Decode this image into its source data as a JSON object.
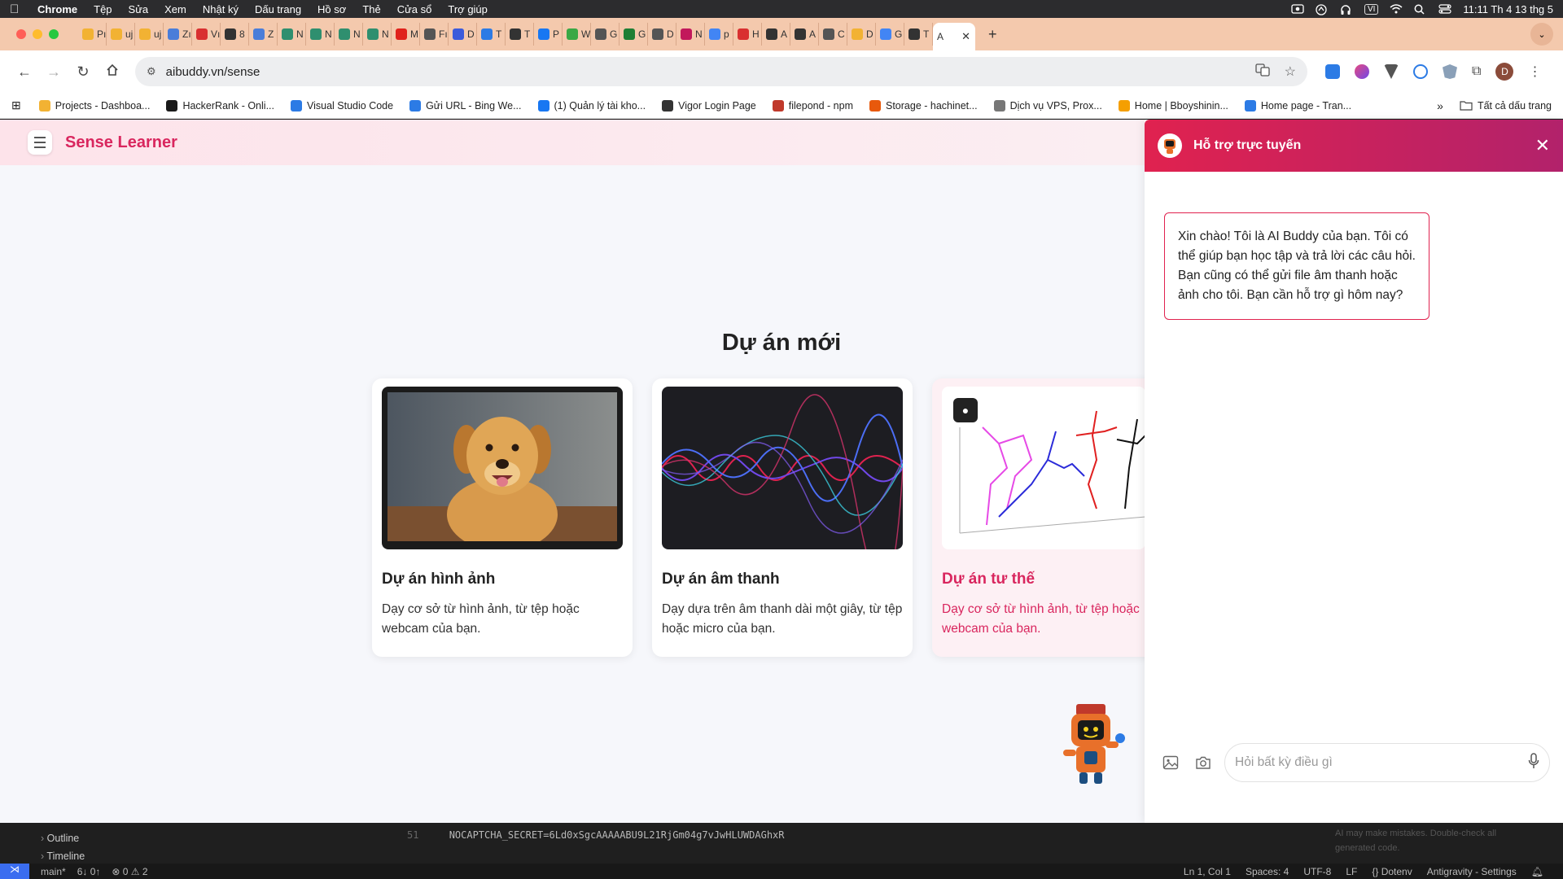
{
  "menubar": {
    "app": "Chrome",
    "items": [
      "Tệp",
      "Sửa",
      "Xem",
      "Nhật ký",
      "Dấu trang",
      "Hồ sơ",
      "Thẻ",
      "Cửa sổ",
      "Trợ giúp"
    ],
    "input_source": "VI",
    "clock": "11:11 Th 4 13 thg 5"
  },
  "tabs": [
    {
      "label": "Pı",
      "color": "#f2b233"
    },
    {
      "label": "uj",
      "color": "#f2b233"
    },
    {
      "label": "uj",
      "color": "#f2b233"
    },
    {
      "label": "Zı",
      "color": "#4a7dd9"
    },
    {
      "label": "Vı",
      "color": "#d93030"
    },
    {
      "label": "8",
      "color": "#333333"
    },
    {
      "label": "Z",
      "color": "#4a7dd9"
    },
    {
      "label": "N",
      "color": "#2f8f6f"
    },
    {
      "label": "N",
      "color": "#2f8f6f"
    },
    {
      "label": "N",
      "color": "#2f8f6f"
    },
    {
      "label": "N",
      "color": "#2f8f6f"
    },
    {
      "label": "M",
      "color": "#e0221b"
    },
    {
      "label": "Fı",
      "color": "#555555"
    },
    {
      "label": "D",
      "color": "#3b5bdb"
    },
    {
      "label": "T",
      "color": "#2c7be5"
    },
    {
      "label": "T",
      "color": "#333333"
    },
    {
      "label": "P",
      "color": "#1877f2"
    },
    {
      "label": "W",
      "color": "#3aa845"
    },
    {
      "label": "G",
      "color": "#555555"
    },
    {
      "label": "G",
      "color": "#1e7e34"
    },
    {
      "label": "D",
      "color": "#555555"
    },
    {
      "label": "N",
      "color": "#c2185b"
    },
    {
      "label": "p",
      "color": "#4285f4"
    },
    {
      "label": "H",
      "color": "#d93030"
    },
    {
      "label": "A",
      "color": "#333333"
    },
    {
      "label": "A",
      "color": "#333333"
    },
    {
      "label": "C",
      "color": "#555555"
    },
    {
      "label": "D",
      "color": "#f2b233"
    },
    {
      "label": "G",
      "color": "#4285f4"
    },
    {
      "label": "T",
      "color": "#333333"
    }
  ],
  "active_tab": {
    "label": "A"
  },
  "toolbar": {
    "url": "aibuddy.vn/sense",
    "profile_initial": "D"
  },
  "bookmarks": {
    "items": [
      {
        "label": "Projects - Dashboa...",
        "color": "#f2b233"
      },
      {
        "label": "HackerRank - Onli...",
        "color": "#1a1a1a"
      },
      {
        "label": "Visual Studio Code",
        "color": "#2c7be5"
      },
      {
        "label": "Gửi URL - Bing We...",
        "color": "#2c7be5"
      },
      {
        "label": "(1) Quản lý tài kho...",
        "color": "#1877f2"
      },
      {
        "label": "Vigor Login Page",
        "color": "#333333"
      },
      {
        "label": "filepond - npm",
        "color": "#c0392b"
      },
      {
        "label": "Storage - hachinet...",
        "color": "#e8590c"
      },
      {
        "label": "Dịch vụ VPS, Prox...",
        "color": "#777777"
      },
      {
        "label": "Home | Bboyshinin...",
        "color": "#f59f00"
      },
      {
        "label": "Home page - Tran...",
        "color": "#2c7be5"
      }
    ],
    "more": "»",
    "all": "Tất cả dấu trang"
  },
  "app": {
    "brand": "Sense Learner",
    "heading": "Dự án mới",
    "cards": [
      {
        "title": "Dự án hình ảnh",
        "desc": "Dạy cơ sở từ hình ảnh, từ tệp hoặc webcam của bạn."
      },
      {
        "title": "Dự án âm thanh",
        "desc": "Dạy dựa trên âm thanh dài một giây, từ tệp hoặc micro của bạn."
      },
      {
        "title": "Dự án tư thế",
        "desc": "Dạy cơ sở từ hình ảnh, từ tệp hoặc webcam của bạn."
      }
    ]
  },
  "chat": {
    "title": "Hỗ trợ trực tuyến",
    "greeting": "Xin chào! Tôi là AI Buddy của bạn. Tôi có thể giúp bạn học tập và trả lời các câu hỏi. Bạn cũng có thể gửi file âm thanh hoặc ảnh cho tôi. Bạn cần hỗ trợ gì hôm nay?",
    "placeholder": "Hỏi bất kỳ điều gì"
  },
  "editor": {
    "outline": "Outline",
    "timeline": "Timeline",
    "line_number": "51",
    "code": "NOCAPTCHA_SECRET=6Ld0xSgcAAAAABU9L21RjGm04g7vJwHLUWDAGhxR",
    "ai_note": "AI may make mistakes. Double-check all generated code."
  },
  "statusbar": {
    "branch": "main*",
    "sync": "6↓ 0↑",
    "problems": "⊗ 0 ⚠ 2",
    "position": "Ln 1, Col 1",
    "spaces": "Spaces: 4",
    "encoding": "UTF-8",
    "eol": "LF",
    "language": "{} Dotenv",
    "settings": "Antigravity - Settings"
  }
}
